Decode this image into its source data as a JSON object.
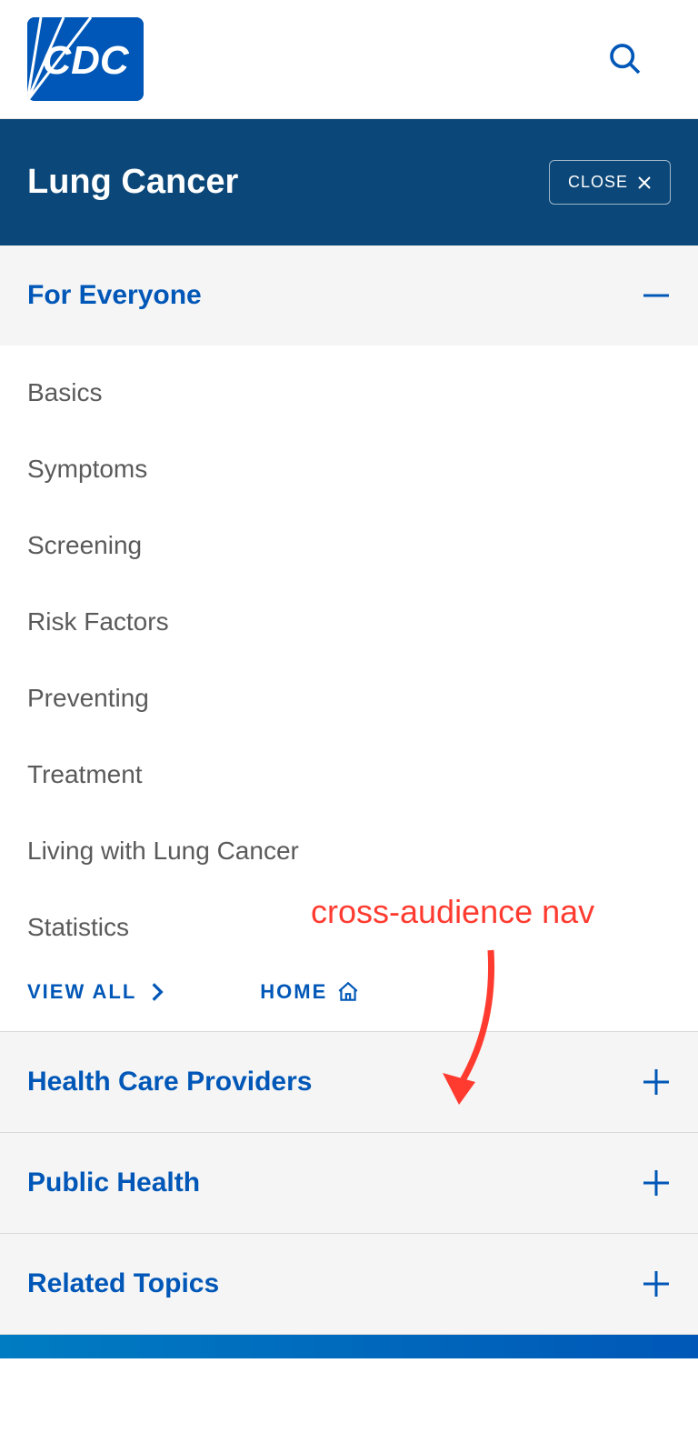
{
  "header": {
    "logo_text": "CDC"
  },
  "titlebar": {
    "title": "Lung Cancer",
    "close_label": "CLOSE"
  },
  "sections": {
    "for_everyone": {
      "title": "For Everyone",
      "expanded": true,
      "items": [
        "Basics",
        "Symptoms",
        "Screening",
        "Risk Factors",
        "Preventing",
        "Treatment",
        "Living with Lung Cancer",
        "Statistics"
      ],
      "view_all_label": "VIEW ALL",
      "home_label": "HOME"
    },
    "health_care_providers": {
      "title": "Health Care Providers",
      "expanded": false
    },
    "public_health": {
      "title": "Public Health",
      "expanded": false
    },
    "related_topics": {
      "title": "Related Topics",
      "expanded": false
    }
  },
  "annotation": {
    "text": "cross-audience nav"
  },
  "colors": {
    "primary_blue": "#0057b7",
    "dark_blue": "#0b4778",
    "annotation_red": "#ff3b30"
  }
}
